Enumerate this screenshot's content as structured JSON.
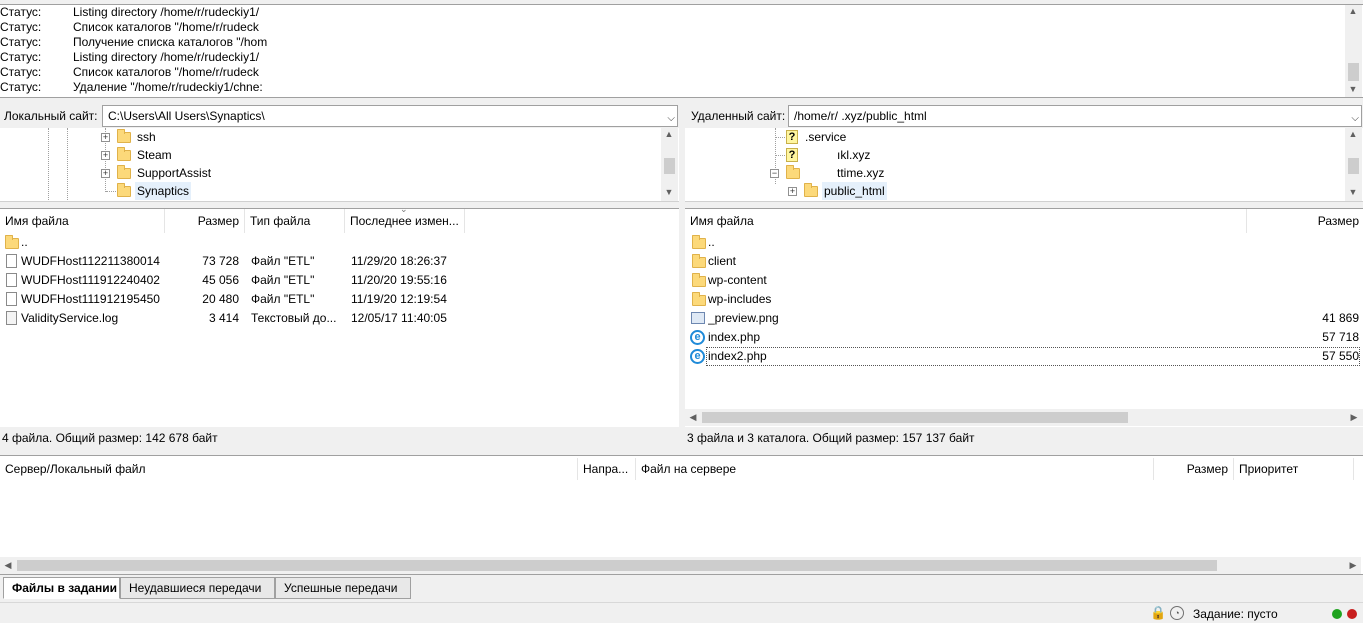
{
  "log": {
    "label": "Статус:",
    "lines": [
      "Listing directory /home/r/rudeckiy1/",
      "Список каталогов \"/home/r/rudeck",
      "Получение списка каталогов \"/hom",
      "Listing directory /home/r/rudeckiy1/",
      "Список каталогов \"/home/r/rudeck",
      "Удаление \"/home/r/rudeckiy1/chne:"
    ]
  },
  "local": {
    "site_label": "Локальный сайт:",
    "path": "C:\\Users\\All Users\\Synaptics\\",
    "tree": [
      "ssh",
      "Steam",
      "SupportAssist",
      "Synaptics"
    ],
    "columns": [
      "Имя файла",
      "Размер",
      "Тип файла",
      "Последнее измен..."
    ],
    "files": [
      {
        "name": "..",
        "size": "",
        "type": "",
        "modified": "",
        "icon": "folder-icon"
      },
      {
        "name": "WUDFHost112211380014...",
        "size": "73 728",
        "type": "Файл \"ETL\"",
        "modified": "11/29/20 18:26:37",
        "icon": "file-icon"
      },
      {
        "name": "WUDFHost111912240402...",
        "size": "45 056",
        "type": "Файл \"ETL\"",
        "modified": "11/20/20 19:55:16",
        "icon": "file-icon"
      },
      {
        "name": "WUDFHost111912195450...",
        "size": "20 480",
        "type": "Файл \"ETL\"",
        "modified": "11/19/20 12:19:54",
        "icon": "file-icon"
      },
      {
        "name": "ValidityService.log",
        "size": "3 414",
        "type": "Текстовый до...",
        "modified": "12/05/17 11:40:05",
        "icon": "text-file-icon"
      }
    ],
    "summary": "4 файла. Общий размер: 142 678 байт"
  },
  "remote": {
    "site_label": "Удаленный сайт:",
    "path": "/home/r/                              .xyz/public_html",
    "tree": [
      ".service",
      "ıkl.xyz",
      "ttime.xyz",
      "public_html"
    ],
    "columns": [
      "Имя файла",
      "Размер"
    ],
    "files": [
      {
        "name": "..",
        "size": "",
        "icon": "folder-icon"
      },
      {
        "name": "client",
        "size": "",
        "icon": "folder-icon"
      },
      {
        "name": "wp-content",
        "size": "",
        "icon": "folder-icon"
      },
      {
        "name": "wp-includes",
        "size": "",
        "icon": "folder-icon"
      },
      {
        "name": "_preview.png",
        "size": "41 869",
        "icon": "image-file-icon"
      },
      {
        "name": "index.php",
        "size": "57 718",
        "icon": "php-file-icon"
      },
      {
        "name": "index2.php",
        "size": "57 550",
        "icon": "php-file-icon"
      }
    ],
    "summary": "3 файла и 3 каталога. Общий размер: 157 137 байт"
  },
  "queue": {
    "columns": [
      "Сервер/Локальный файл",
      "Напра...",
      "Файл на сервере",
      "Размер",
      "Приоритет"
    ]
  },
  "tabs": [
    "Файлы в задании",
    "Неудавшиеся передачи",
    "Успешные передачи"
  ],
  "statusbar": {
    "queue_text": "Задание: пусто"
  },
  "colors": {
    "folder": "#fcd97a",
    "lamp_green": "#1fa31f",
    "lamp_red": "#c81e1e"
  }
}
